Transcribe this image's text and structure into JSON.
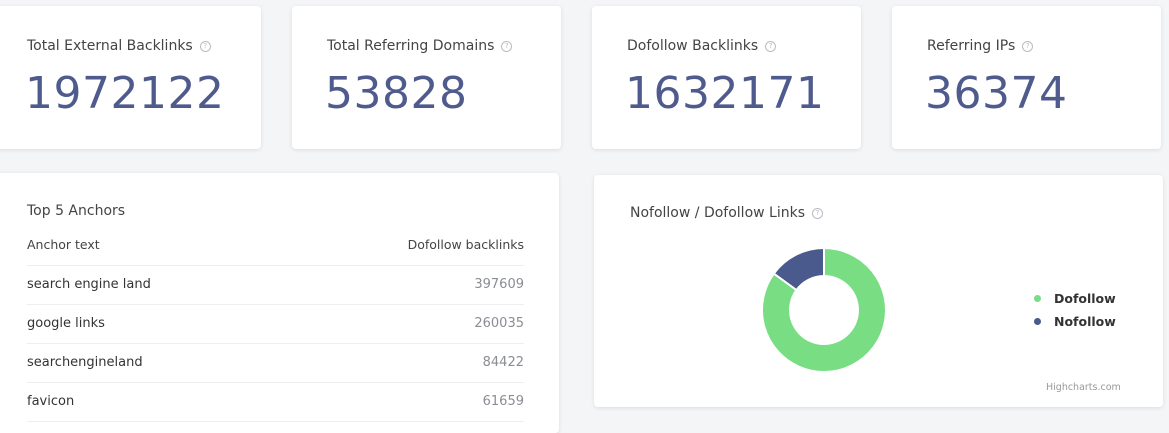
{
  "stats": [
    {
      "label": "Total External Backlinks",
      "value": "1972122"
    },
    {
      "label": "Total Referring Domains",
      "value": "53828"
    },
    {
      "label": "Dofollow Backlinks",
      "value": "1632171"
    },
    {
      "label": "Referring IPs",
      "value": "36374"
    }
  ],
  "help_glyph": "?",
  "anchors": {
    "title": "Top 5 Anchors",
    "columns": [
      "Anchor text",
      "Dofollow backlinks"
    ],
    "rows": [
      {
        "text": "search engine land",
        "count": "397609"
      },
      {
        "text": "google links",
        "count": "260035"
      },
      {
        "text": "searchengineland",
        "count": "84422"
      },
      {
        "text": "favicon",
        "count": "61659"
      }
    ]
  },
  "link_chart": {
    "title": "Nofollow / Dofollow Links",
    "credits": "Highcharts.com"
  },
  "chart_data": {
    "type": "pie",
    "donut": true,
    "series": [
      {
        "name": "",
        "data": [
          {
            "label": "Dofollow",
            "value": 85,
            "color": "#78dd83"
          },
          {
            "label": "Nofollow",
            "value": 15,
            "color": "#4a5a8c"
          }
        ]
      }
    ],
    "legend": "right"
  },
  "colors": {
    "accent_number": "#4f5b8c",
    "dofollow": "#78dd83",
    "nofollow": "#4a5a8c"
  }
}
